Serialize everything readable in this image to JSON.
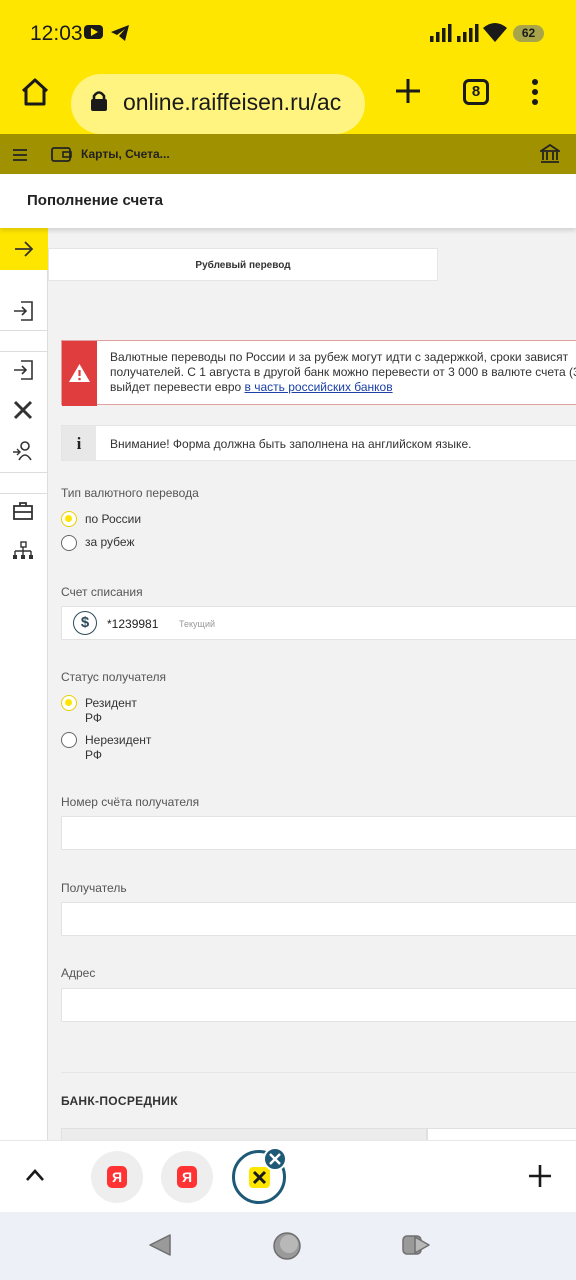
{
  "status_bar": {
    "time": "12:03",
    "battery": "62",
    "icons": [
      "youtube-icon",
      "telegram-icon",
      "signal-icon",
      "signal-icon",
      "wifi-icon",
      "battery-icon"
    ]
  },
  "browser": {
    "url": "online.raiffeisen.ru/ac",
    "tab_count": "8",
    "accent_color": "#fee600"
  },
  "site_header": {
    "breadcrumb": "Карты, Счета..."
  },
  "page": {
    "title": "Пополнение счета",
    "tab_label": "Рублевый перевод",
    "alert": {
      "line1": "Валютные переводы по России и за рубеж могут идти с задержкой, сроки зависят",
      "line2": "получателей. С 1 августа в другой банк можно перевести от 3 000 в валюте счета (3",
      "line3_prefix": "выйдет перевести евро ",
      "line3_link": "в часть российских банков"
    },
    "info": "Внимание! Форма должна быть заполнена на английском языке.",
    "transfer_type": {
      "label": "Тип валютного перевода",
      "options": [
        "по России",
        "за рубеж"
      ],
      "selected": 0
    },
    "debit_account": {
      "label": "Счет списания",
      "number": "*1239981",
      "type": "Текущий",
      "currency_symbol": "$"
    },
    "recipient_status": {
      "label": "Статус получателя",
      "options": [
        "Резидент РФ",
        "Нерезидент РФ"
      ],
      "selected": 0
    },
    "fields": {
      "account_number_label": "Номер счёта получателя",
      "recipient_label": "Получатель",
      "address_label": "Адрес"
    },
    "intermediary_section": "БАНК-ПОСРЕДНИК"
  }
}
